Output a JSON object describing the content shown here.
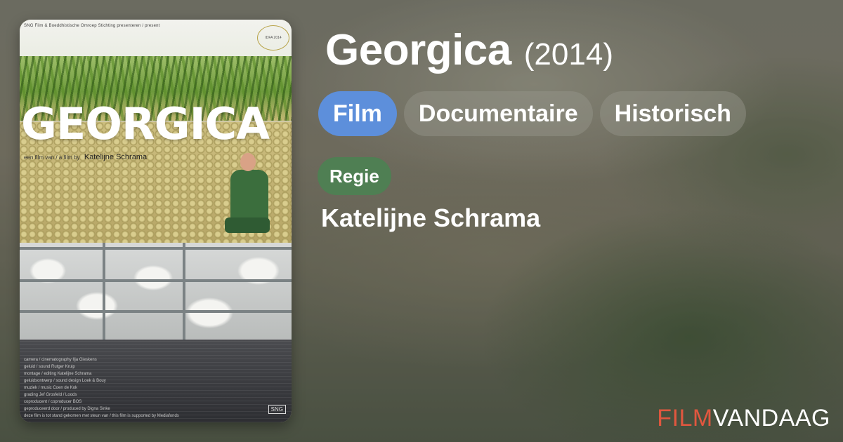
{
  "film": {
    "title": "Georgica",
    "year": "(2014)"
  },
  "tags": [
    "Film",
    "Documentaire",
    "Historisch"
  ],
  "crew": {
    "role": "Regie",
    "name": "Katelijne Schrama"
  },
  "poster": {
    "title": "GEORGICA",
    "top_credit": "SNG Film & Boeddhistische Omroep Stichting presenteren / present",
    "subtitle_prefix": "een film van / a film by",
    "director": "Katelijne Schrama",
    "laurel": "IDFA 2014",
    "credits": [
      "camera / cinematography Ilja Gieskens",
      "geluid / sound Rutger Kruip",
      "montage / editing Katelijne Schrama",
      "geluidsontwerp / sound design Loek & Bouy",
      "muziek / music Coen de Kok",
      "grading Jef Grosfeld / Loods",
      "coproducent / coproducer BOS",
      "geproduceerd door / produced by Digna Sinke",
      "deze film is tot stand gekomen met steun van / this film is supported by Mediafonds"
    ],
    "logo": "SNG"
  },
  "brand": {
    "part1": "FILM",
    "part2": "VANDAAG"
  },
  "colors": {
    "tag_primary": "#5d8fdb",
    "role_badge": "#4f7f53",
    "brand_accent": "#e0573f"
  }
}
